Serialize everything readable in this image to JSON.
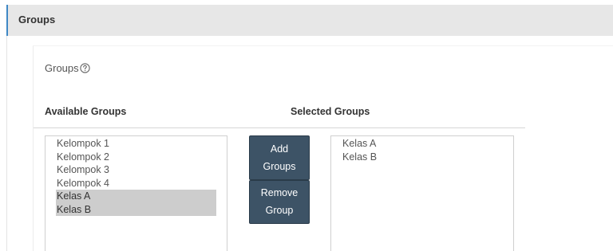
{
  "panel": {
    "title": "Groups"
  },
  "field": {
    "label": "Groups",
    "help_icon": "question-circle-icon"
  },
  "columns": {
    "available_header": "Available Groups",
    "selected_header": "Selected Groups"
  },
  "available_groups": [
    {
      "label": "Kelompok 1",
      "selected": false
    },
    {
      "label": "Kelompok 2",
      "selected": false
    },
    {
      "label": "Kelompok 3",
      "selected": false
    },
    {
      "label": "Kelompok 4",
      "selected": false
    },
    {
      "label": "Kelas A",
      "selected": true
    },
    {
      "label": "Kelas B",
      "selected": true
    }
  ],
  "selected_groups": [
    {
      "label": "Kelas A"
    },
    {
      "label": "Kelas B"
    }
  ],
  "buttons": {
    "add_line1": "Add",
    "add_line2": "Groups",
    "remove_line1": "Remove",
    "remove_line2": "Group"
  },
  "colors": {
    "accent": "#3f88c5",
    "button_bg": "#3d5366",
    "header_bg": "#e7e7e7",
    "selection_bg": "#cdcdcd"
  }
}
